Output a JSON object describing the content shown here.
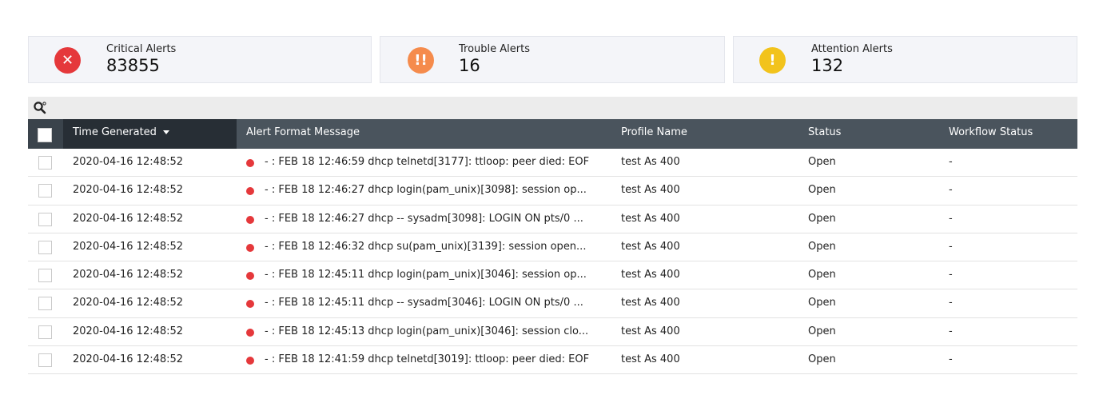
{
  "cards": {
    "critical": {
      "label": "Critical Alerts",
      "value": "83855",
      "icon": "x-circle-icon",
      "icon_glyph": "✕",
      "color": "#e5383b"
    },
    "trouble": {
      "label": "Trouble Alerts",
      "value": "16",
      "icon": "double-exclamation-icon",
      "icon_glyph": "!!",
      "color": "#f58b4c"
    },
    "attention": {
      "label": "Attention Alerts",
      "value": "132",
      "icon": "exclamation-icon",
      "icon_glyph": "!",
      "color": "#f2c31c"
    }
  },
  "toolbar": {
    "icon": "search-icon"
  },
  "table": {
    "columns": {
      "time": "Time Generated",
      "message": "Alert Format Message",
      "profile": "Profile Name",
      "status": "Status",
      "workflow": "Workflow Status"
    },
    "rows": [
      {
        "time": "2020-04-16 12:48:52",
        "message": "- : FEB 18 12:46:59 dhcp telnetd[3177]: ttloop: peer died: EOF",
        "profile": "test As 400",
        "status": "Open",
        "workflow": "-"
      },
      {
        "time": "2020-04-16 12:48:52",
        "message": "- : FEB 18 12:46:27 dhcp login(pam_unix)[3098]: session op...",
        "profile": "test As 400",
        "status": "Open",
        "workflow": "-"
      },
      {
        "time": "2020-04-16 12:48:52",
        "message": "- : FEB 18 12:46:27 dhcp -- sysadm[3098]: LOGIN ON pts/0 ...",
        "profile": "test As 400",
        "status": "Open",
        "workflow": "-"
      },
      {
        "time": "2020-04-16 12:48:52",
        "message": "- : FEB 18 12:46:32 dhcp su(pam_unix)[3139]: session open...",
        "profile": "test As 400",
        "status": "Open",
        "workflow": "-"
      },
      {
        "time": "2020-04-16 12:48:52",
        "message": "- : FEB 18 12:45:11 dhcp login(pam_unix)[3046]: session op...",
        "profile": "test As 400",
        "status": "Open",
        "workflow": "-"
      },
      {
        "time": "2020-04-16 12:48:52",
        "message": "- : FEB 18 12:45:11 dhcp -- sysadm[3046]: LOGIN ON pts/0 ...",
        "profile": "test As 400",
        "status": "Open",
        "workflow": "-"
      },
      {
        "time": "2020-04-16 12:48:52",
        "message": "- : FEB 18 12:45:13 dhcp login(pam_unix)[3046]: session clo...",
        "profile": "test As 400",
        "status": "Open",
        "workflow": "-"
      },
      {
        "time": "2020-04-16 12:48:52",
        "message": "- : FEB 18 12:41:59 dhcp telnetd[3019]: ttloop: peer died: EOF",
        "profile": "test As 400",
        "status": "Open",
        "workflow": "-"
      }
    ]
  }
}
